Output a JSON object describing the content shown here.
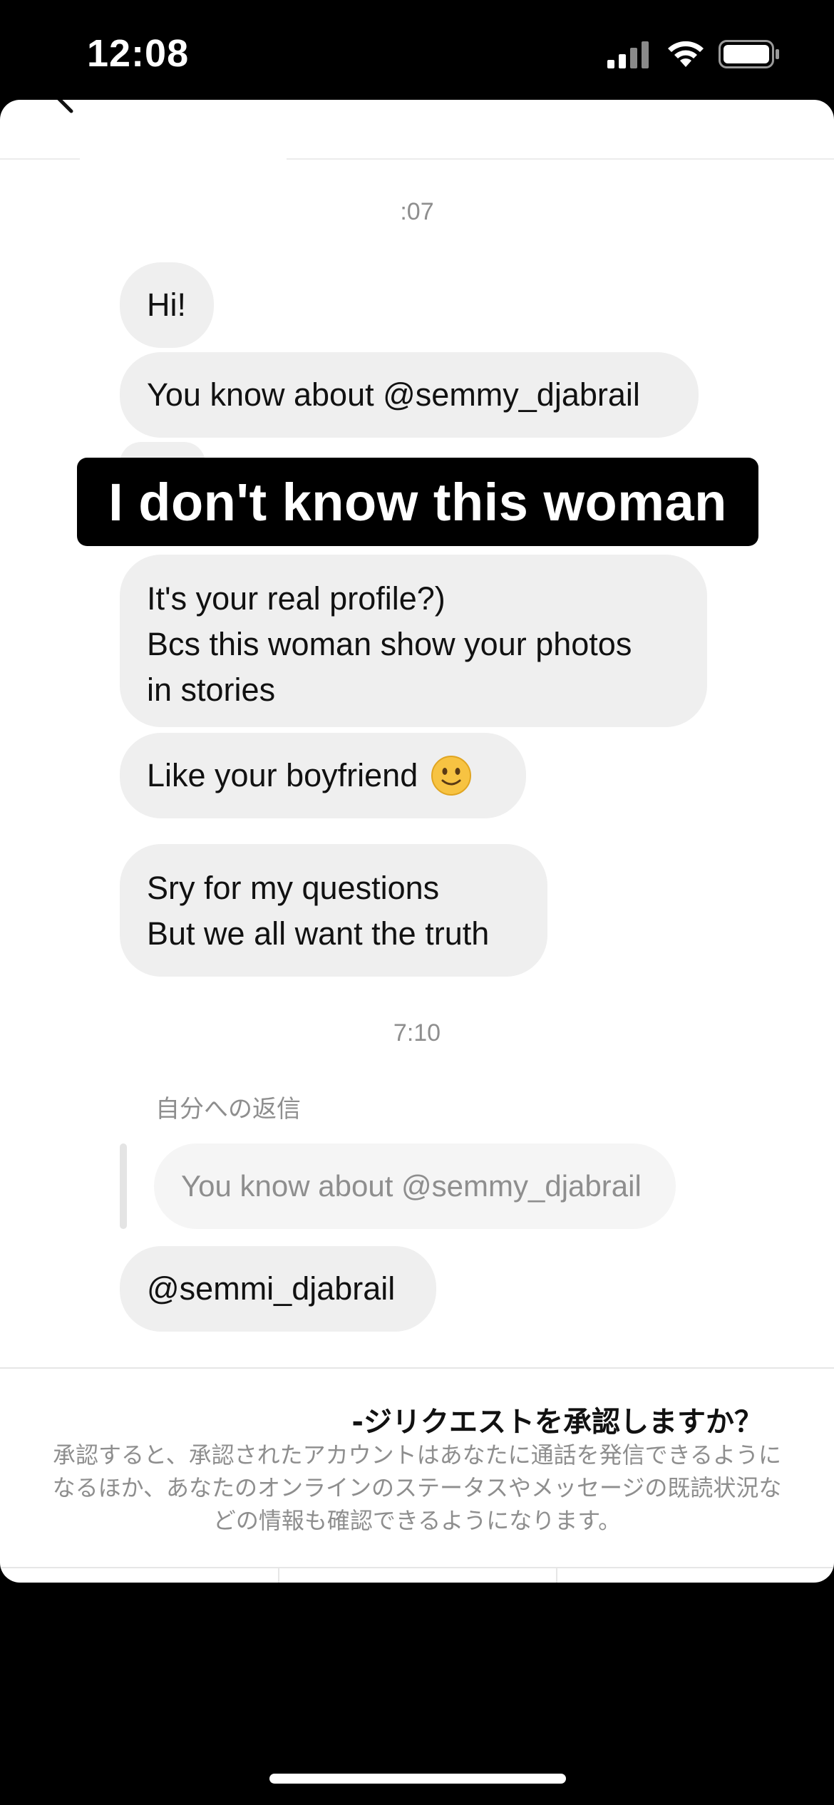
{
  "status_bar": {
    "time": "12:08",
    "icons": [
      "signal-icon",
      "wifi-icon",
      "battery-icon"
    ]
  },
  "header": {
    "back_icon": "chevron-left-icon"
  },
  "messages": {
    "timestamp_1": ":07",
    "hi": "Hi!",
    "know_about": "You know about @semmy_djabrail",
    "real_profile_lines": [
      "It's your real profile?)",
      "Bcs this woman show your photos",
      "in stories"
    ],
    "boyfriend": "Like your boyfriend",
    "boyfriend_emoji": "slightly-smiling-face-icon",
    "sorry_lines": [
      "Sry for my questions",
      "But we all want the truth"
    ],
    "timestamp_2": "7:10",
    "reply_label": "自分への返信",
    "reply_quote": "You know about @semmy_djabrail",
    "semmi": "@semmi_djabrail"
  },
  "overlay": {
    "text": "I don't know this woman"
  },
  "request": {
    "title": "-ジリクエストを承認しますか？",
    "description": "承認すると、承認されたアカウントはあなたに通話を発信できるようになるほか、あなたのオンラインのステータスやメッセージの既読状況などの情報も確認できるようになります。"
  },
  "colors": {
    "bubble_bg": "#efefef",
    "overlay_bg": "#000000",
    "muted_text": "#8e8e8e"
  }
}
